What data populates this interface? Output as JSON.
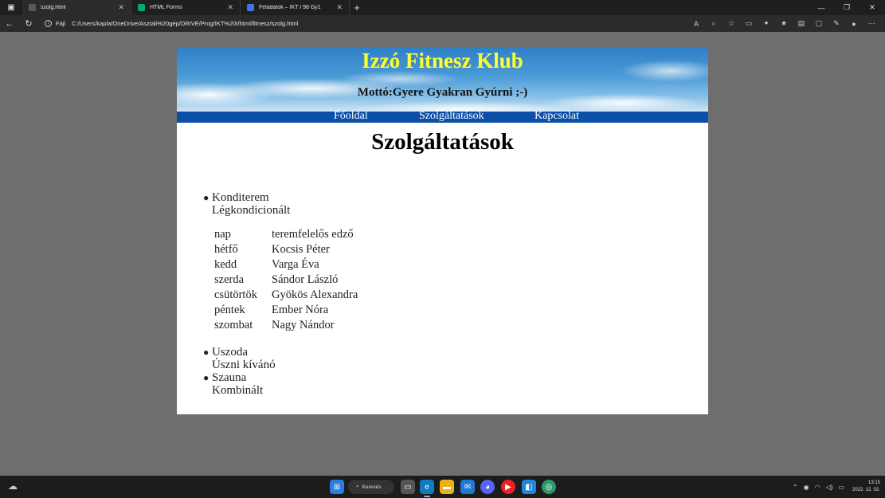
{
  "browser": {
    "tabs": [
      {
        "title": "szolg.html",
        "active": true,
        "favicon_color": "#5a5a5a"
      },
      {
        "title": "HTML Forms",
        "active": false,
        "favicon_color": "#04aa6d"
      },
      {
        "title": "Feladatok – IKT I 98 Gy1",
        "active": false,
        "favicon_color": "#3b78e7"
      }
    ],
    "address": {
      "protocol_label": "Fájl",
      "url": "C:/Users/kapla/OneDrive/Asztali%20gép/DRIVE/Prog/IKT%20I/html/fitnesz/szolg.html"
    }
  },
  "site": {
    "title": "Izzó Fitnesz Klub",
    "motto": "Mottó:Gyere Gyakran Gyúrni ;-)",
    "nav": [
      "Főoldal",
      "Szolgáltatások",
      "Kapcsolat"
    ],
    "page_heading": "Szolgáltatások",
    "services": [
      {
        "name": "Konditerem",
        "desc": "Légkondicionált"
      },
      {
        "name": "Uszoda",
        "desc": "Úszni kívánó"
      },
      {
        "name": "Szauna",
        "desc": "Kombinált"
      }
    ],
    "schedule": {
      "headers": [
        "nap",
        "teremfelelős edző"
      ],
      "rows": [
        [
          "hétfő",
          "Kocsis Péter"
        ],
        [
          "kedd",
          "Varga Éva"
        ],
        [
          "szerda",
          "Sándor László"
        ],
        [
          "csütörtök",
          "Gyökös Alexandra"
        ],
        [
          "péntek",
          "Ember Nóra"
        ],
        [
          "szombat",
          "Nagy Nándor"
        ]
      ]
    }
  },
  "taskbar": {
    "search_label": "Keresés",
    "time": "13:15",
    "date": "2022. 12. 02."
  },
  "colors": {
    "title_yellow": "#ffff33",
    "nav_blue": "#0b4fa8",
    "page_bg": "#6e6e6e"
  }
}
